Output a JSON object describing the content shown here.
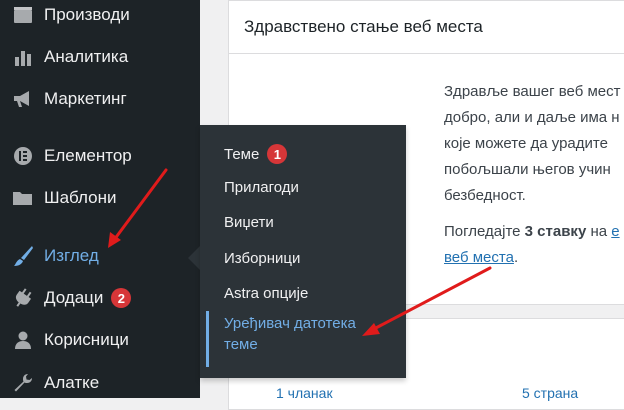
{
  "sidebar": {
    "items": [
      {
        "label": "Производи",
        "icon": "products-icon"
      },
      {
        "label": "Аналитика",
        "icon": "analytics-icon"
      },
      {
        "label": "Маркетинг",
        "icon": "megaphone-icon"
      },
      {
        "label": "Елементор",
        "icon": "elementor-icon"
      },
      {
        "label": "Шаблони",
        "icon": "folder-icon"
      },
      {
        "label": "Изглед",
        "icon": "paintbrush-icon",
        "active": true
      },
      {
        "label": "Додаци",
        "icon": "plugin-icon",
        "badge": "2"
      },
      {
        "label": "Корисници",
        "icon": "user-icon"
      },
      {
        "label": "Алатке",
        "icon": "wrench-icon"
      }
    ]
  },
  "flyout": {
    "items": [
      {
        "label": "Теме",
        "badge": "1"
      },
      {
        "label": "Прилагоди"
      },
      {
        "label": "Виџети"
      },
      {
        "label": "Изборници"
      },
      {
        "label": "Astra опције"
      },
      {
        "label_line1": "Уређивач датотека",
        "label_line2": "теме",
        "current": true
      }
    ]
  },
  "card": {
    "title": "Здравствено стање веб места",
    "lines": [
      "Здравље вашег веб мест",
      "добро, али и даље има н",
      "које можете да урадите",
      "побољшали његов учин",
      "безбедност."
    ],
    "line2_prefix": "Погледајте ",
    "line2_bold": "3 ставку",
    "line2_mid": " на ",
    "line2_link_start": "e",
    "line2_link": "веб места",
    "line2_end": "."
  },
  "footer": {
    "left": "1 чланак",
    "right": "5 страна"
  },
  "colors": {
    "sidebar_bg": "#1d2327",
    "flyout_bg": "#2c3338",
    "accent": "#72aee6",
    "badge": "#d63638",
    "arrow": "#e01b1b"
  }
}
